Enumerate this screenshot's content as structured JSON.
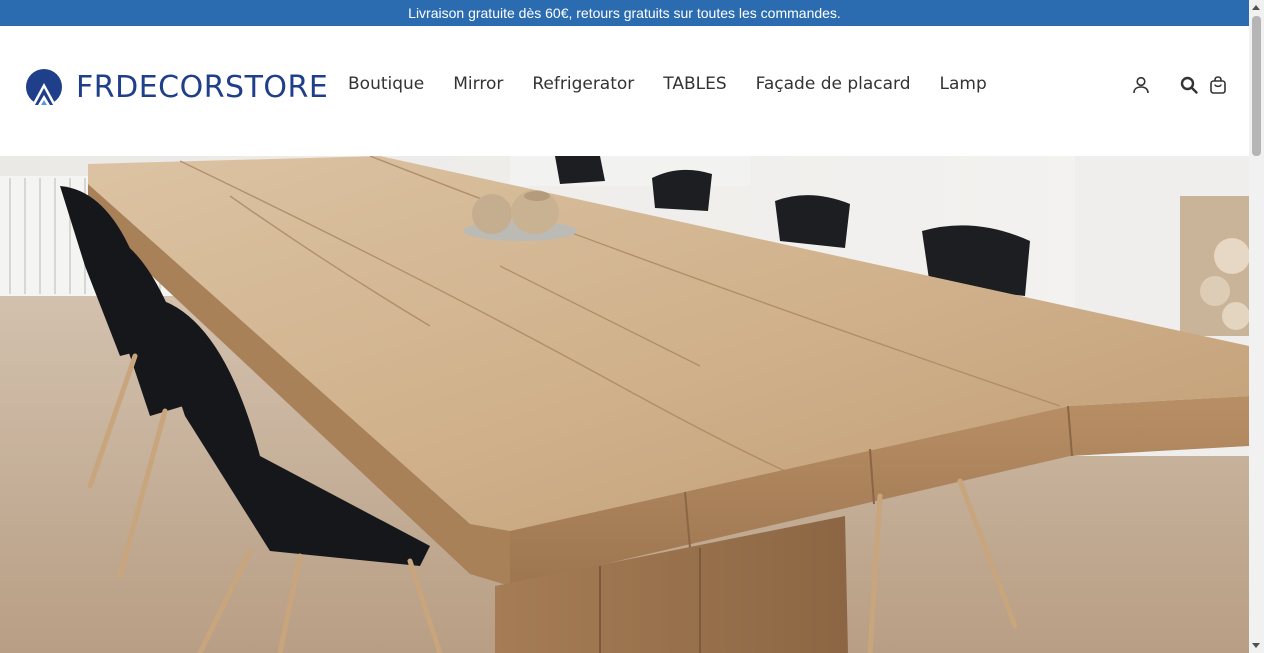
{
  "announcement": {
    "text": "Livraison gratuite dès 60€, retours gratuits sur toutes les commandes."
  },
  "header": {
    "logo_text": "FRDECORSTORE",
    "nav": [
      {
        "label": "Boutique"
      },
      {
        "label": "Mirror"
      },
      {
        "label": "Refrigerator"
      },
      {
        "label": "TABLES"
      },
      {
        "label": "Façade de placard"
      },
      {
        "label": "Lamp"
      }
    ],
    "icons": [
      "account-icon",
      "search-icon",
      "cart-icon"
    ]
  },
  "hero": {
    "image": "wooden-dining-table-with-black-chairs"
  },
  "colors": {
    "announcement_bg": "#2b6cb0",
    "logo_blue": "#1f3f8a",
    "nav_text": "#333333"
  }
}
